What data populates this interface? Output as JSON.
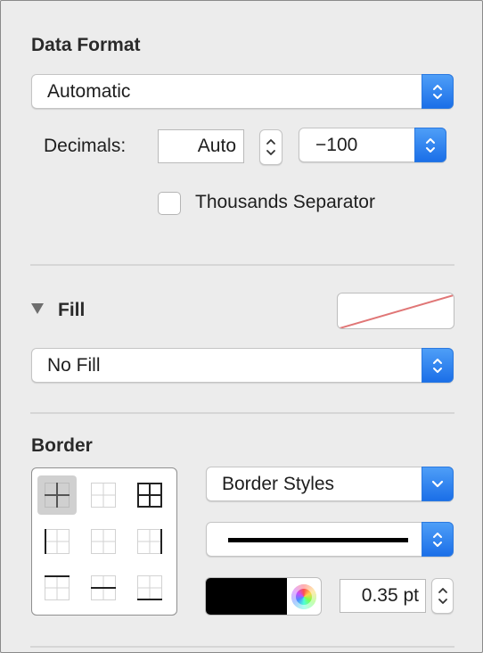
{
  "data_format": {
    "title": "Data Format",
    "format_value": "Automatic",
    "decimals_label": "Decimals:",
    "decimals_value": "Auto",
    "negative_value": "−100",
    "thousands_label": "Thousands Separator",
    "thousands_checked": false
  },
  "fill": {
    "title": "Fill",
    "fill_value": "No Fill"
  },
  "border": {
    "title": "Border",
    "styles_value": "Border Styles",
    "color": "#000000",
    "width_value": "0.35 pt"
  },
  "colors": {
    "accent": "#2f7ff0",
    "no_fill_swatch_line": "#e07676"
  }
}
